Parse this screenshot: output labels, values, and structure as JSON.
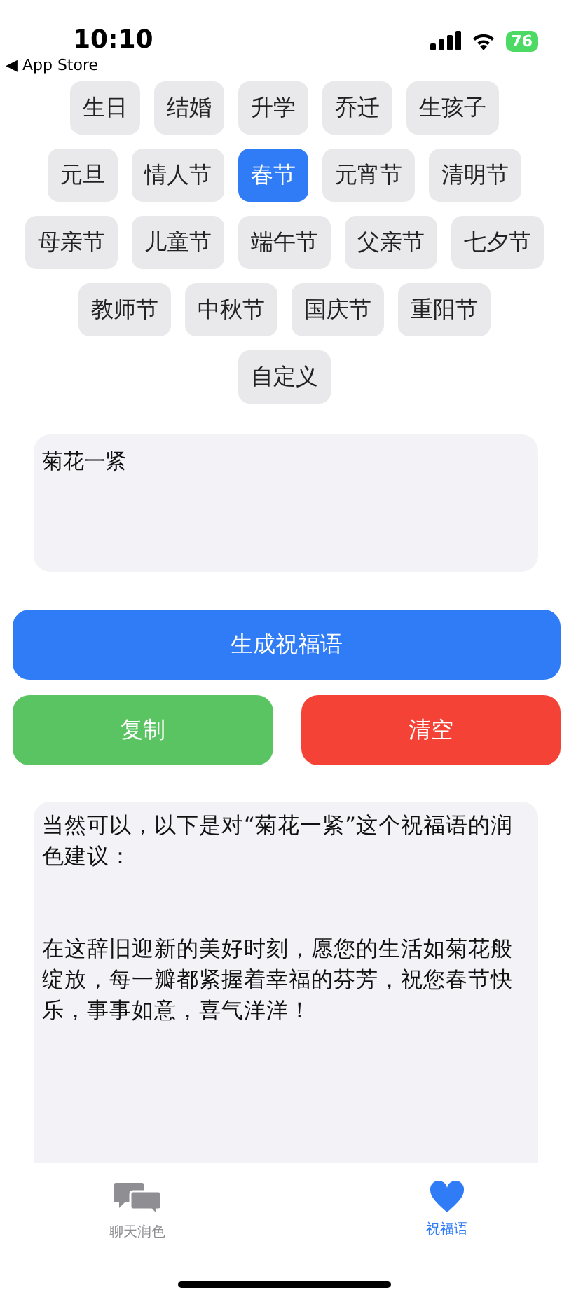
{
  "status_bar": {
    "time": "10:10",
    "back_link": "◀ App Store",
    "battery": "76"
  },
  "occasion_rows": [
    [
      {
        "label": "生日",
        "selected": false
      },
      {
        "label": "结婚",
        "selected": false
      },
      {
        "label": "升学",
        "selected": false
      },
      {
        "label": "乔迁",
        "selected": false
      },
      {
        "label": "生孩子",
        "selected": false
      }
    ],
    [
      {
        "label": "元旦",
        "selected": false
      },
      {
        "label": "情人节",
        "selected": false
      },
      {
        "label": "春节",
        "selected": true
      },
      {
        "label": "元宵节",
        "selected": false
      },
      {
        "label": "清明节",
        "selected": false
      }
    ],
    [
      {
        "label": "母亲节",
        "selected": false
      },
      {
        "label": "儿童节",
        "selected": false
      },
      {
        "label": "端午节",
        "selected": false
      },
      {
        "label": "父亲节",
        "selected": false
      },
      {
        "label": "七夕节",
        "selected": false
      }
    ],
    [
      {
        "label": "教师节",
        "selected": false
      },
      {
        "label": "中秋节",
        "selected": false
      },
      {
        "label": "国庆节",
        "selected": false
      },
      {
        "label": "重阳节",
        "selected": false
      }
    ],
    [
      {
        "label": "自定义",
        "selected": false
      }
    ]
  ],
  "input": {
    "value": "菊花一紧"
  },
  "buttons": {
    "generate": "生成祝福语",
    "copy": "复制",
    "clear": "清空"
  },
  "result": [
    "当然可以，以下是对“菊花一紧”这个祝福语的润色建议：",
    "在这辞旧迎新的美好时刻，愿您的生活如菊花般绽放，每一瓣都紧握着幸福的芬芳，祝您春节快乐，事事如意，喜气洋洋！"
  ],
  "tab_bar": [
    {
      "label": "聊天润色",
      "kind": "chat",
      "selected": false
    },
    {
      "label": "祝福语",
      "kind": "heart",
      "selected": true
    }
  ]
}
